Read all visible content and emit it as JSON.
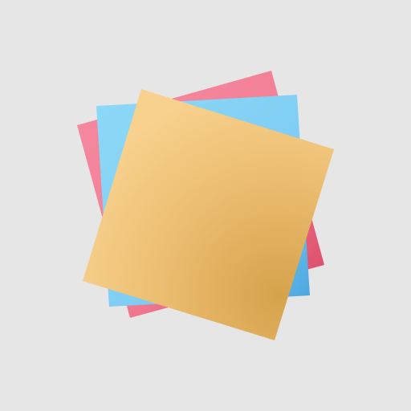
{
  "icon": {
    "name": "sticky-notes-stack-icon",
    "colors": {
      "background": "#e6e6e6",
      "pink_note_light": "#f58aa0",
      "pink_note_dark": "#d8425f",
      "blue_note_light": "#8ed9f8",
      "blue_note_dark": "#4aa5de",
      "yellow_note_light": "#f8d18e",
      "yellow_note_dark": "#d6a24c"
    }
  }
}
